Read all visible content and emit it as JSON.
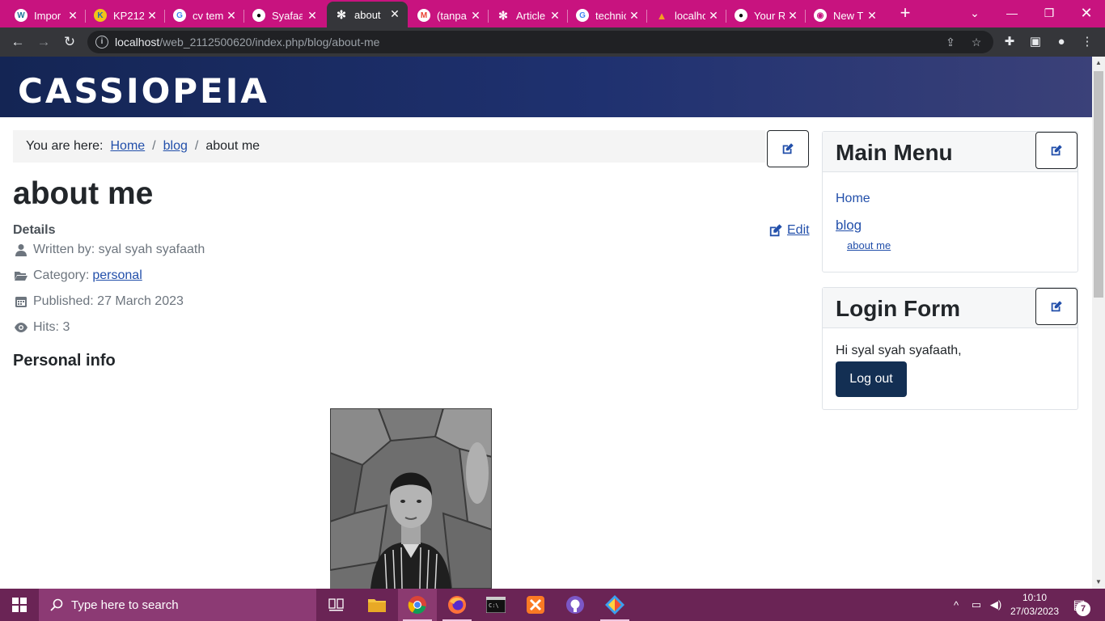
{
  "browser": {
    "tabs": [
      {
        "title": "Impor",
        "icon": "wordpress-icon"
      },
      {
        "title": "KP212",
        "icon": "site-favicon-icon"
      },
      {
        "title": "cv tem",
        "icon": "google-icon"
      },
      {
        "title": "Syafaa",
        "icon": "github-icon"
      },
      {
        "title": "about",
        "icon": "joomla-icon"
      },
      {
        "title": "(tanpa",
        "icon": "gmail-icon"
      },
      {
        "title": "Article",
        "icon": "joomla-icon"
      },
      {
        "title": "technic",
        "icon": "google-icon"
      },
      {
        "title": "localho",
        "icon": "xampp-icon"
      },
      {
        "title": "Your R",
        "icon": "github-icon"
      },
      {
        "title": "New T",
        "icon": "chrome-icon"
      }
    ],
    "active_tab_index": 4,
    "url_host": "localhost",
    "url_path": "/web_2112500620/index.php/blog/about-me"
  },
  "site": {
    "brand": "CASSIOPEIA"
  },
  "breadcrumb": {
    "prefix": "You are here:",
    "items": [
      "Home",
      "blog",
      "about me"
    ]
  },
  "article": {
    "title": "about me",
    "details_label": "Details",
    "edit_label": "Edit",
    "written_by": "Written by: syal syah syafaath",
    "category_label": "Category:",
    "category_value": "personal",
    "published": "Published: 27 March 2023",
    "hits": "Hits: 3",
    "section_heading": "Personal info"
  },
  "main_menu": {
    "title": "Main Menu",
    "items": [
      "Home",
      "blog",
      "about me"
    ]
  },
  "login_form": {
    "title": "Login Form",
    "greeting": "Hi syal syah syafaath,",
    "logout_label": "Log out"
  },
  "taskbar": {
    "search_placeholder": "Type here to search",
    "time": "10:10",
    "date": "27/03/2023",
    "notification_count": "7"
  },
  "colors": {
    "tabstrip": "#c8137f",
    "header_start": "#142554",
    "header_end": "#3b4179",
    "link": "#224faa",
    "logout_button": "#132f53",
    "taskbar": "#6a2455"
  }
}
